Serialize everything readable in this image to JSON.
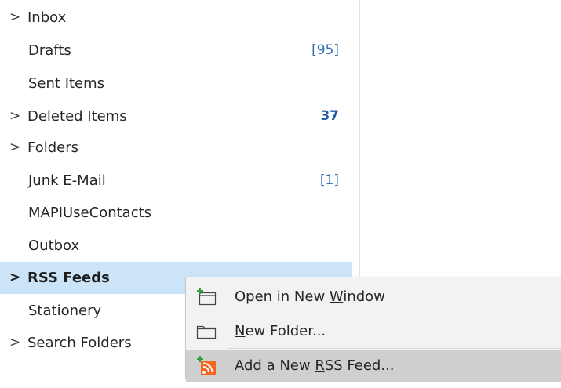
{
  "folders": [
    {
      "label": "Inbox",
      "expandable": true,
      "count": "",
      "bold_count": false
    },
    {
      "label": "Drafts",
      "expandable": false,
      "count": "[95]",
      "bold_count": false
    },
    {
      "label": "Sent Items",
      "expandable": false,
      "count": "",
      "bold_count": false
    },
    {
      "label": "Deleted Items",
      "expandable": true,
      "count": "37",
      "bold_count": true
    },
    {
      "label": "Folders",
      "expandable": true,
      "count": "",
      "bold_count": false
    },
    {
      "label": "Junk E-Mail",
      "expandable": false,
      "count": "[1]",
      "bold_count": false
    },
    {
      "label": "MAPIUseContacts",
      "expandable": false,
      "count": "",
      "bold_count": false
    },
    {
      "label": "Outbox",
      "expandable": false,
      "count": "",
      "bold_count": false
    },
    {
      "label": "RSS Feeds",
      "expandable": true,
      "count": "",
      "bold_count": false,
      "selected": true
    },
    {
      "label": "Stationery",
      "expandable": false,
      "count": "",
      "bold_count": false
    },
    {
      "label": "Search Folders",
      "expandable": true,
      "count": "",
      "bold_count": false
    }
  ],
  "chevron": ">",
  "context_menu": {
    "items": [
      {
        "pre": "Open in New ",
        "accel": "W",
        "post": "indow",
        "icon": "new-window-icon"
      },
      {
        "pre": "",
        "accel": "N",
        "post": "ew Folder...",
        "icon": "folder-icon"
      },
      {
        "pre": "Add a New ",
        "accel": "R",
        "post": "SS Feed...",
        "icon": "rss-add-icon",
        "highlighted": true
      }
    ]
  },
  "colors": {
    "selection": "#cce4f7",
    "count": "#2f6fb5",
    "rss_orange": "#f26522",
    "add_green": "#2e9e3a"
  }
}
